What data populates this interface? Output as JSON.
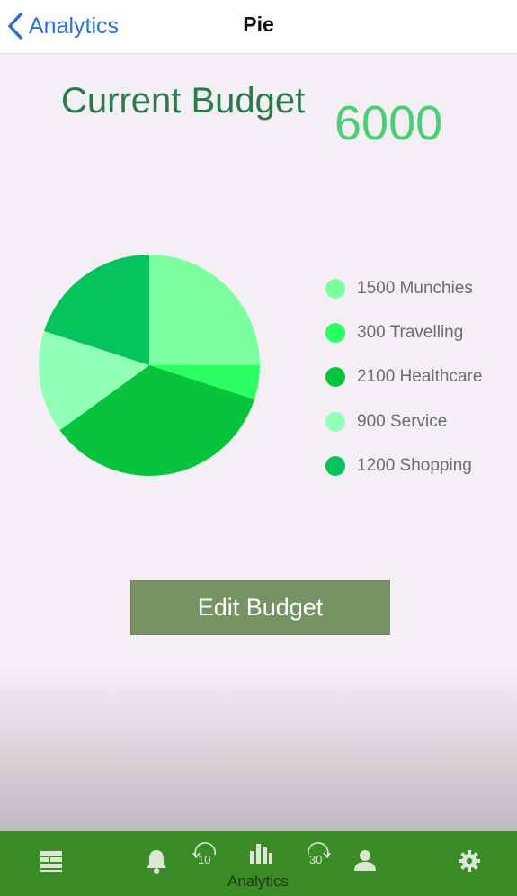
{
  "nav": {
    "back_label": "Analytics",
    "title": "Pie"
  },
  "budget": {
    "label": "Current Budget",
    "value": "6000"
  },
  "chart_data": {
    "type": "pie",
    "start_angle_deg": 0,
    "slices": [
      {
        "label": "Munchies",
        "value": 1500,
        "display": "1500 Munchies",
        "color": "#7cff9e"
      },
      {
        "label": "Travelling",
        "value": 300,
        "display": "300 Travelling",
        "color": "#2bff62"
      },
      {
        "label": "Healthcare",
        "value": 2100,
        "display": "2100 Healthcare",
        "color": "#08c43c"
      },
      {
        "label": "Service",
        "value": 900,
        "display": "900 Service",
        "color": "#92ffb6"
      },
      {
        "label": "Shopping",
        "value": 1200,
        "display": "1200 Shopping",
        "color": "#06c45d"
      }
    ]
  },
  "edit_button": {
    "label": "Edit Budget"
  },
  "tabbar": {
    "active_label": "Analytics",
    "skip_back": "10",
    "skip_forward": "30",
    "icons": [
      "list-icon",
      "bell-icon",
      "skip-back-icon",
      "analytics-icon",
      "skip-forward-icon",
      "profile-icon",
      "gear-icon"
    ],
    "color": "#3b8c26"
  }
}
